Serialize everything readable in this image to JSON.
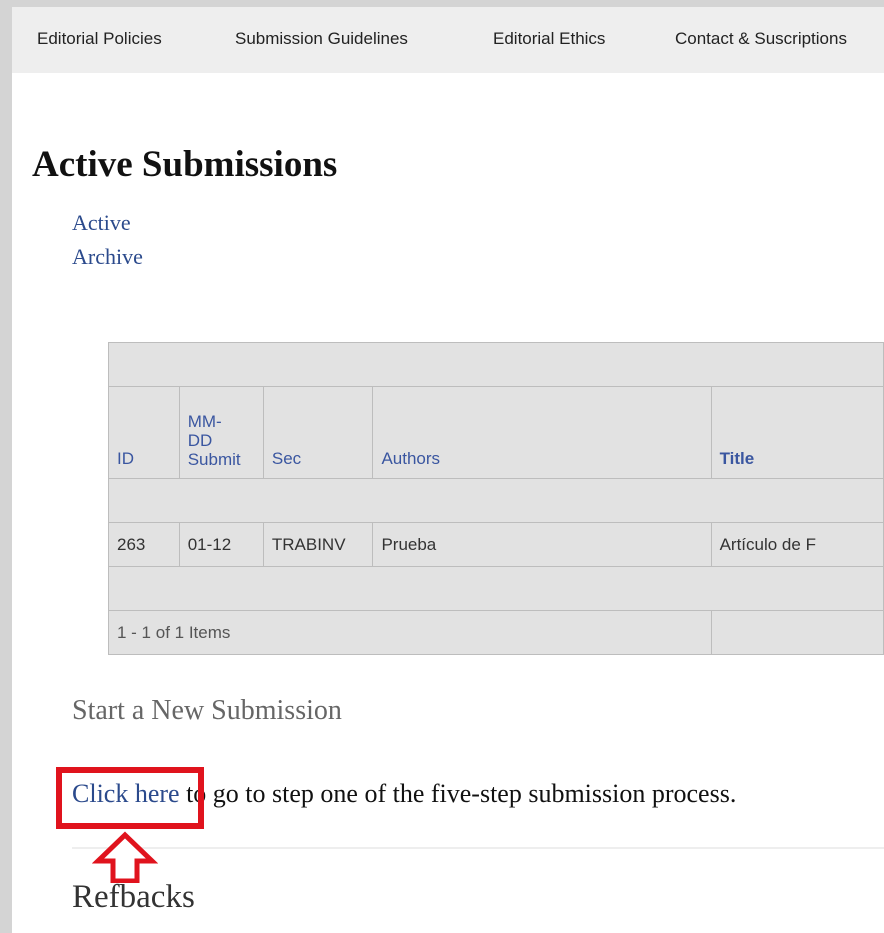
{
  "topnav": {
    "items": [
      {
        "label": "Editorial Policies"
      },
      {
        "label": "Submission Guidelines"
      },
      {
        "label": "Editorial Ethics"
      },
      {
        "label": "Contact & Suscriptions"
      }
    ]
  },
  "page": {
    "title": "Active Submissions",
    "links": {
      "active": "Active",
      "archive": "Archive"
    }
  },
  "table": {
    "headers": {
      "id": "ID",
      "date_line1": "MM-",
      "date_line2": "DD",
      "date_line3": "Submit",
      "sec": "Sec",
      "authors": "Authors",
      "title": "Title"
    },
    "rows": [
      {
        "id": "263",
        "date": "01-12",
        "sec": "TRABINV",
        "authors": "Prueba",
        "title": "Artículo de F"
      }
    ],
    "pagination": "1 - 1 of 1 Items"
  },
  "new_submission": {
    "heading": "Start a New Submission",
    "link": "Click here",
    "text": "to go to step one of the five-step submission process."
  },
  "refbacks": {
    "heading": "Refbacks"
  },
  "colors": {
    "highlight": "#e0131d",
    "link": "#2b4a8c"
  }
}
